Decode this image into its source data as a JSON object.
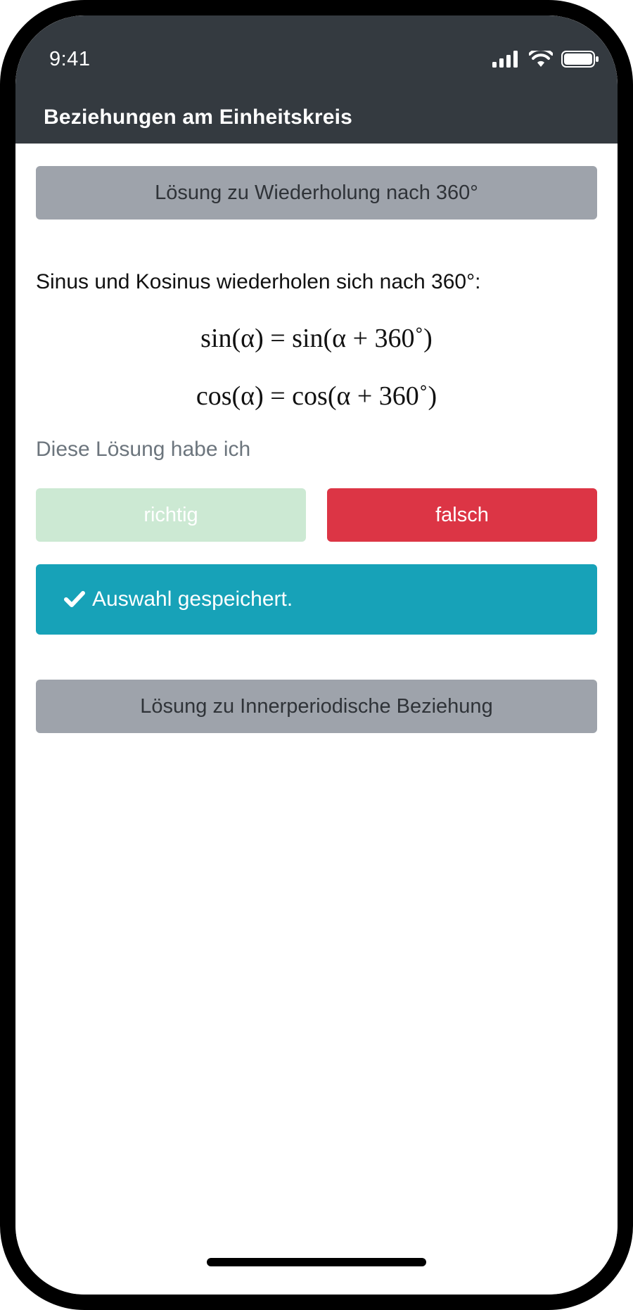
{
  "status_bar": {
    "time": "9:41"
  },
  "header": {
    "title": "Beziehungen am Einheitskreis"
  },
  "solution_button_1": {
    "label": "Lösung zu Wiederholung nach 360°"
  },
  "solution": {
    "text": "Sinus und Kosinus wiederholen sich nach 360°:",
    "formula_sin": "sin(α) = sin(α + 360˚)",
    "formula_cos": "cos(α) = cos(α + 360˚)"
  },
  "self_assessment": {
    "prompt": "Diese Lösung habe ich",
    "correct_label": "richtig",
    "wrong_label": "falsch"
  },
  "alert": {
    "message": "Auswahl gespeichert."
  },
  "solution_button_2": {
    "label": "Lösung zu Innerperiodische Beziehung"
  },
  "colors": {
    "header_bg": "#343a40",
    "button_gray": "#9ea3ab",
    "correct_light": "#cce9d3",
    "wrong": "#dc3545",
    "alert_info": "#17a2b8"
  },
  "icons": {
    "signal": "cellular-signal-icon",
    "wifi": "wifi-icon",
    "battery": "battery-icon",
    "check": "check-icon"
  }
}
